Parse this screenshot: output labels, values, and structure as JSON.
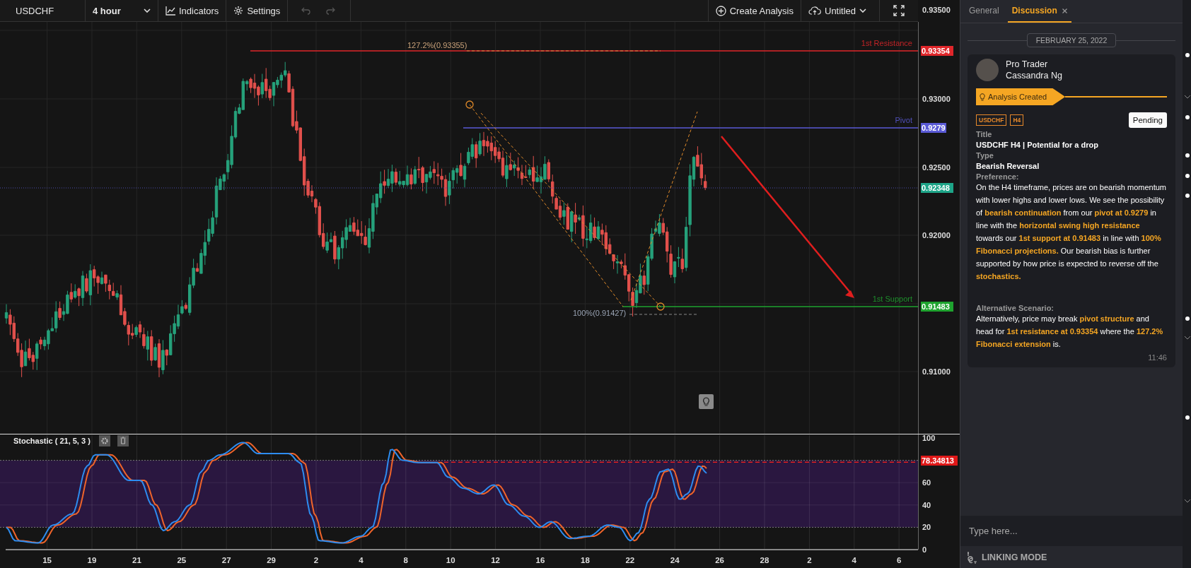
{
  "toolbar": {
    "symbol": "USDCHF",
    "timeframe": "4 hour",
    "tools": [
      {
        "kind": "indicators",
        "label": "Indicators"
      },
      {
        "kind": "settings",
        "label": "Settings"
      }
    ],
    "history": [
      {
        "kind": "undo",
        "disabled": true
      },
      {
        "kind": "redo",
        "disabled": true
      }
    ],
    "create_analysis": "Create Analysis",
    "layout_name": "Untitled"
  },
  "chart": {
    "price_ticks": [
      "0.93500",
      "0.93000",
      "0.92500",
      "0.92000",
      "0.91000"
    ],
    "price_lines": [
      {
        "kind": "level",
        "label": "1st Resistance",
        "tag": "0.93354",
        "color": "#e0262a"
      },
      {
        "kind": "level",
        "label": "Pivot",
        "tag": "0.9279",
        "color": "#5a5ad6"
      },
      {
        "kind": "last",
        "tag": "0.92348",
        "color": "#1ea588"
      },
      {
        "kind": "level",
        "label": "1st Support",
        "tag": "0.91483",
        "color": "#1fa32f"
      }
    ],
    "fib_labels": [
      "127.2%(0.93355)",
      "100%(0.91427)"
    ]
  },
  "stochastic": {
    "title": "Stochastic ( 21, 5, 3 )",
    "ticks": [
      "100",
      "60",
      "40",
      "20",
      "0"
    ],
    "value_tag": "78.34813"
  },
  "date_axis": [
    "15",
    "19",
    "21",
    "25",
    "27",
    "29",
    "2",
    "4",
    "8",
    "10",
    "12",
    "16",
    "18",
    "22",
    "24",
    "26",
    "28",
    "2",
    "4",
    "6"
  ],
  "panel": {
    "tabs": [
      {
        "label": "General",
        "selected": false,
        "closable": false
      },
      {
        "label": "Discussion",
        "selected": true,
        "closable": true
      }
    ],
    "date": "FEBRUARY 25, 2022",
    "message": {
      "role": "Pro Trader",
      "author": "Cassandra Ng",
      "status": "Analysis Created",
      "tags": [
        "USDCHF",
        "H4"
      ],
      "status_button": "Pending",
      "fields": [
        {
          "kind": "heading",
          "label": "Title",
          "value": "USDCHF H4 | Potential for a drop"
        },
        {
          "kind": "heading",
          "label": "Type",
          "value": "Bearish Reversal"
        },
        {
          "kind": "paragraph",
          "label": "Preference:",
          "value": "On the H4 timeframe, prices are on bearish momentum with lower highs and lower lows. We see the possibility of **bearish continuation** from our  **pivot at 0.9279** in line with the **horizontal swing high resistance** towards our **1st support at 0.91483**  in line with **100% Fibonacci projections.** Our bearish bias is further supported by how price is expected to reverse off the **stochastics.**"
        },
        {
          "kind": "paragraph",
          "label": "Alternative Scenario:",
          "value": "Alternatively, price may break **pivot structure** and head for **1st resistance at 0.93354** where the **127.2% Fibonacci extension** is."
        }
      ],
      "time": "11:46"
    },
    "input": {
      "placeholder": "Type here..."
    },
    "footer": "LINKING MODE"
  }
}
